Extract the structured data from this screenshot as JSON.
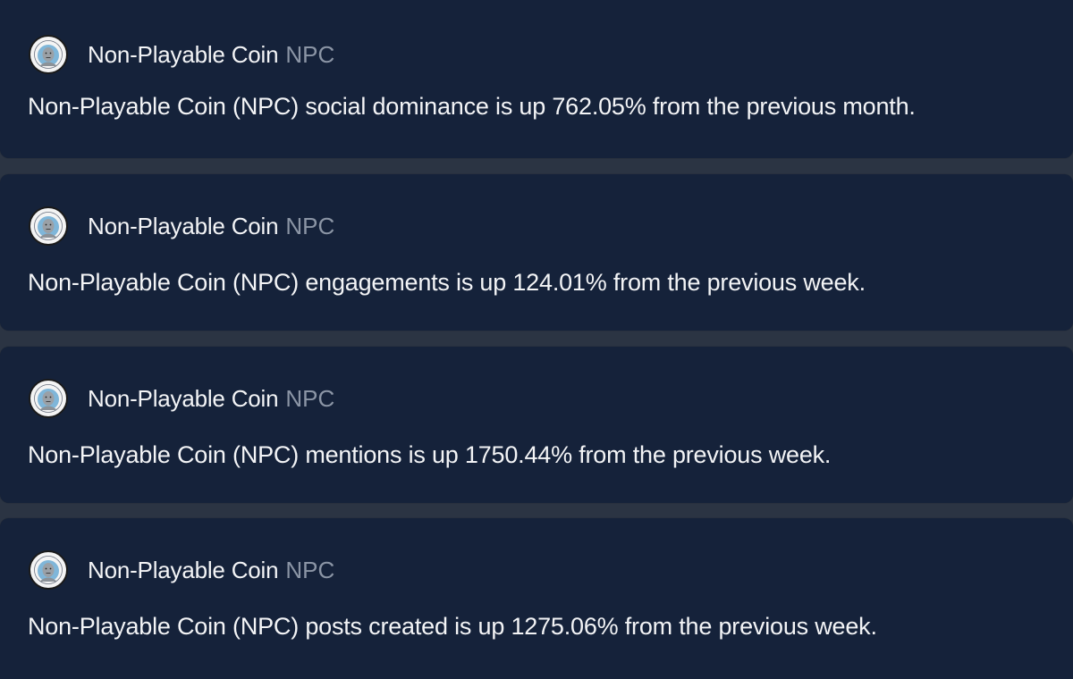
{
  "colors": {
    "page_background": "#2b3443",
    "card_background": "#15223a",
    "name_text": "#f3f4f6",
    "ticker_text": "#8b95a5"
  },
  "feed": {
    "items": [
      {
        "avatar_icon": "npc-coin-logo-icon",
        "coin_name": "Non-Playable Coin",
        "ticker": "NPC",
        "message": "Non-Playable Coin (NPC) social dominance is up 762.05% from the previous month."
      },
      {
        "avatar_icon": "npc-coin-logo-icon",
        "coin_name": "Non-Playable Coin",
        "ticker": "NPC",
        "message": "Non-Playable Coin (NPC) engagements is up 124.01% from the previous week."
      },
      {
        "avatar_icon": "npc-coin-logo-icon",
        "coin_name": "Non-Playable Coin",
        "ticker": "NPC",
        "message": "Non-Playable Coin (NPC) mentions is up 1750.44% from the previous week."
      },
      {
        "avatar_icon": "npc-coin-logo-icon",
        "coin_name": "Non-Playable Coin",
        "ticker": "NPC",
        "message": "Non-Playable Coin (NPC) posts created is up 1275.06% from the previous week."
      }
    ]
  }
}
